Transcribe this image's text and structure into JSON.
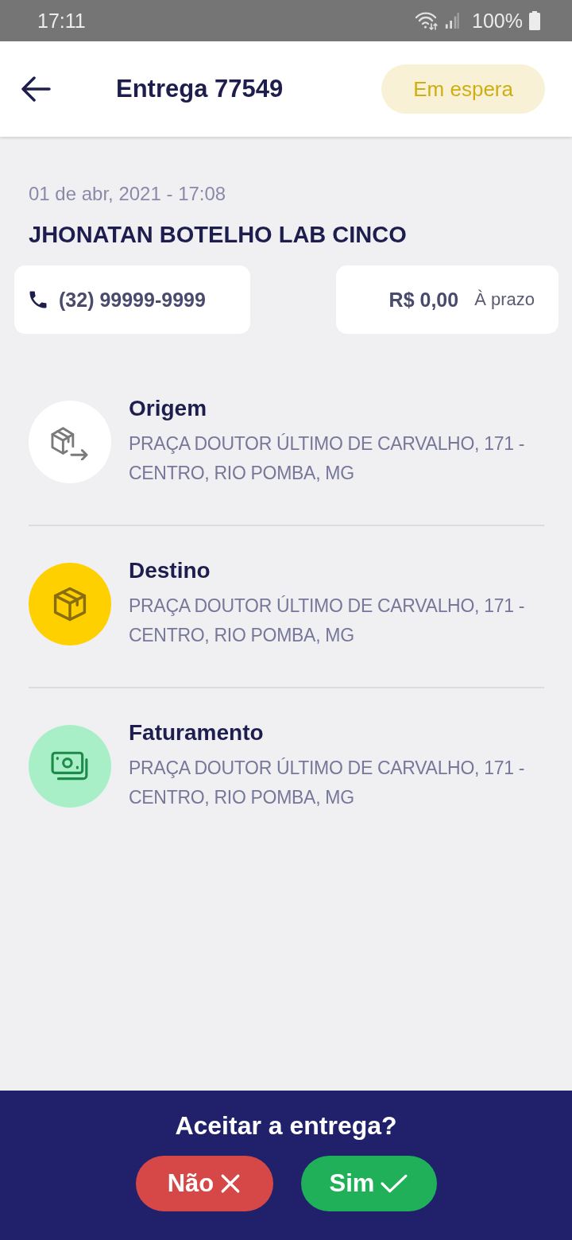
{
  "status_bar": {
    "time": "17:11",
    "battery": "100%"
  },
  "header": {
    "title": "Entrega 77549",
    "status": "Em espera"
  },
  "order": {
    "date": "01 de abr, 2021 - 17:08",
    "customer": "JHONATAN BOTELHO LAB CINCO",
    "phone": "(32) 99999-9999",
    "price": "R$ 0,00",
    "payment_term": "À prazo"
  },
  "locations": [
    {
      "kind": "origin",
      "title": "Origem",
      "address": "PRAÇA DOUTOR ÚLTIMO DE CARVALHO, 171 - CENTRO, RIO POMBA, MG"
    },
    {
      "kind": "destination",
      "title": "Destino",
      "address": "PRAÇA DOUTOR ÚLTIMO DE CARVALHO, 171 - CENTRO, RIO POMBA, MG"
    },
    {
      "kind": "billing",
      "title": "Faturamento",
      "address": "PRAÇA DOUTOR ÚLTIMO DE CARVALHO, 171 - CENTRO, RIO POMBA, MG"
    }
  ],
  "footer": {
    "question": "Aceitar a entrega?",
    "buttons": [
      {
        "kind": "reject",
        "label": "Não"
      },
      {
        "kind": "accept",
        "label": "Sim"
      }
    ]
  }
}
